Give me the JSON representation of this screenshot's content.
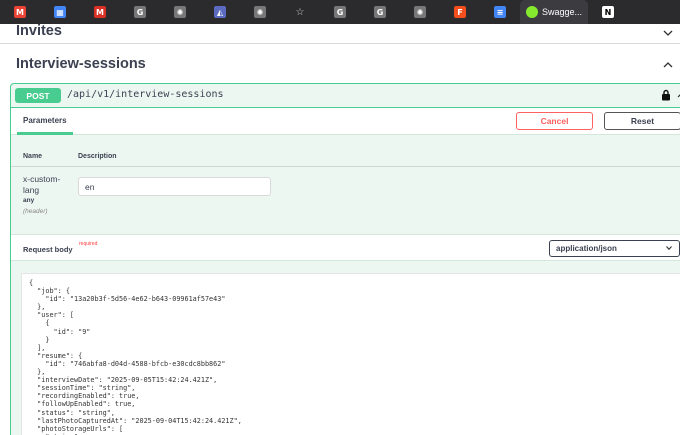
{
  "browser": {
    "tabs": [
      {
        "icon": "gmail-icon",
        "color": "#ea4335",
        "glyph": "M"
      },
      {
        "icon": "calendar-icon",
        "color": "#4285f4",
        "glyph": "▦"
      },
      {
        "icon": "gmail-icon",
        "color": "#d93025",
        "glyph": "M"
      },
      {
        "icon": "grammarly-icon",
        "color": "#777",
        "glyph": "G"
      },
      {
        "icon": "openai-icon",
        "color": "#777",
        "glyph": "✺"
      },
      {
        "icon": "analytics-icon",
        "color": "#5c6bc0",
        "glyph": "◭"
      },
      {
        "icon": "openai-icon",
        "color": "#777",
        "glyph": "✺"
      },
      {
        "icon": "star-icon",
        "color": "transparent",
        "glyph": "☆"
      },
      {
        "icon": "grammarly-icon",
        "color": "#777",
        "glyph": "G"
      },
      {
        "icon": "grammarly-icon",
        "color": "#777",
        "glyph": "G"
      },
      {
        "icon": "openai-icon",
        "color": "#777",
        "glyph": "✺"
      },
      {
        "icon": "figma-icon",
        "color": "#f24e1e",
        "glyph": "F"
      },
      {
        "icon": "docs-icon",
        "color": "#4285f4",
        "glyph": "≡"
      }
    ],
    "active_tab_title": "Swagge...",
    "active_tab_icon": "swagger-icon",
    "last_tab_icon": "notion-icon"
  },
  "sections": {
    "invites": "Invites",
    "interview_sessions": "Interview-sessions"
  },
  "operation": {
    "method": "POST",
    "path": "/api/v1/interview-sessions",
    "params_tab": "Parameters",
    "cancel": "Cancel",
    "reset": "Reset",
    "col_name": "Name",
    "col_description": "Description",
    "param": {
      "name": "x-custom-lang",
      "type": "any",
      "in": "(header)",
      "value": "en"
    },
    "request_body": "Request body",
    "required": "required",
    "content_type": "application/json",
    "body_json": "{\n  \"job\": {\n    \"id\": \"13a20b3f-5d56-4e62-b643-09961af57e43\"\n  },\n  \"user\": [\n    {\n      \"id\": \"9\"\n    }\n  ],\n  \"resume\": {\n    \"id\": \"746abfa8-d04d-4588-bfcb-e30cdc8bb862\"\n  },\n  \"interviewDate\": \"2025-09-05T15:42:24.421Z\",\n  \"sessionTime\": \"string\",\n  \"recordingEnabled\": true,\n  \"followUpEnabled\": true,\n  \"status\": \"string\",\n  \"lastPhotoCapturedAt\": \"2025-09-04T15:42:24.421Z\",\n  \"photoStorageUrls\": [\n    \"string\"\n  ],"
  },
  "colors": {
    "post_green": "#49cc90",
    "cancel_red": "#ff6060"
  }
}
